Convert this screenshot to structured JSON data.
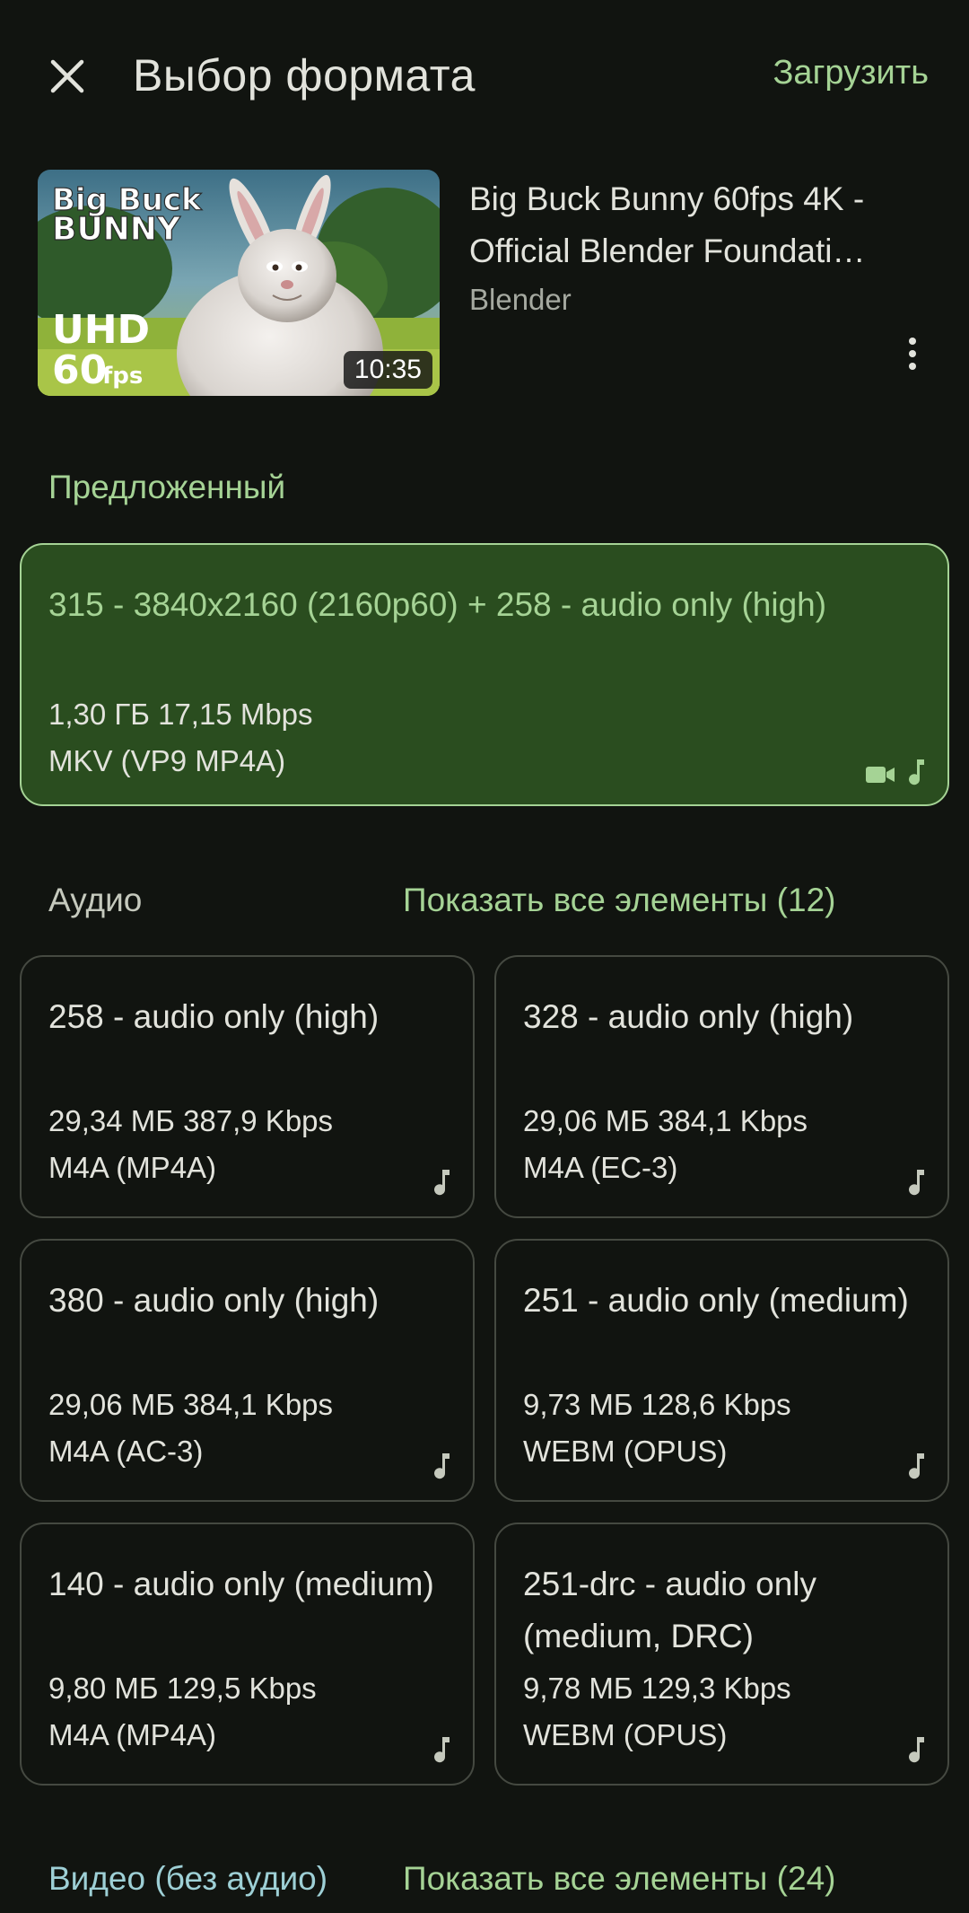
{
  "header": {
    "title": "Выбор формата",
    "download_label": "Загрузить"
  },
  "video": {
    "title": "Big Buck Bunny 60fps 4K - Official Blender Foundati…",
    "channel": "Blender",
    "duration": "10:35",
    "thumb_text": {
      "line1": "Big Buck",
      "line2": "BUNNY",
      "uhd": "UHD",
      "fps_num": "60",
      "fps_unit": "fps"
    }
  },
  "suggested": {
    "label": "Предложенный",
    "card": {
      "title": "315 - 3840x2160 (2160p60) + 258 - audio only (high)",
      "size": "1,30 ГБ 17,15 Mbps",
      "codec": "MKV (VP9 MP4A)",
      "icons": [
        "video-camera-icon",
        "music-note-icon"
      ]
    }
  },
  "audio": {
    "label": "Аудио",
    "show_all": "Показать все элементы (12)",
    "cards": [
      {
        "title": "258 - audio only (high)",
        "size": "29,34 МБ 387,9 Kbps",
        "codec": "M4A (MP4A)"
      },
      {
        "title": "328 - audio only (high)",
        "size": "29,06 МБ 384,1 Kbps",
        "codec": "M4A (EC-3)"
      },
      {
        "title": "380 - audio only (high)",
        "size": "29,06 МБ 384,1 Kbps",
        "codec": "M4A (AC-3)"
      },
      {
        "title": "251 - audio only (medium)",
        "size": "9,73 МБ 128,6 Kbps",
        "codec": "WEBM (OPUS)"
      },
      {
        "title": "140 - audio only (medium)",
        "size": "9,80 МБ 129,5 Kbps",
        "codec": "M4A (MP4A)"
      },
      {
        "title": "251-drc - audio only (medium, DRC)",
        "size": "9,78 МБ 129,3 Kbps",
        "codec": "WEBM (OPUS)"
      }
    ]
  },
  "video_only": {
    "label": "Видео (без аудио)",
    "show_all": "Показать все элементы (24)"
  },
  "colors": {
    "background": "#111410",
    "accent": "#a5d395",
    "selected_bg": "#2a4d1f",
    "card_border": "#454941",
    "video_section": "#9ed0d6"
  }
}
